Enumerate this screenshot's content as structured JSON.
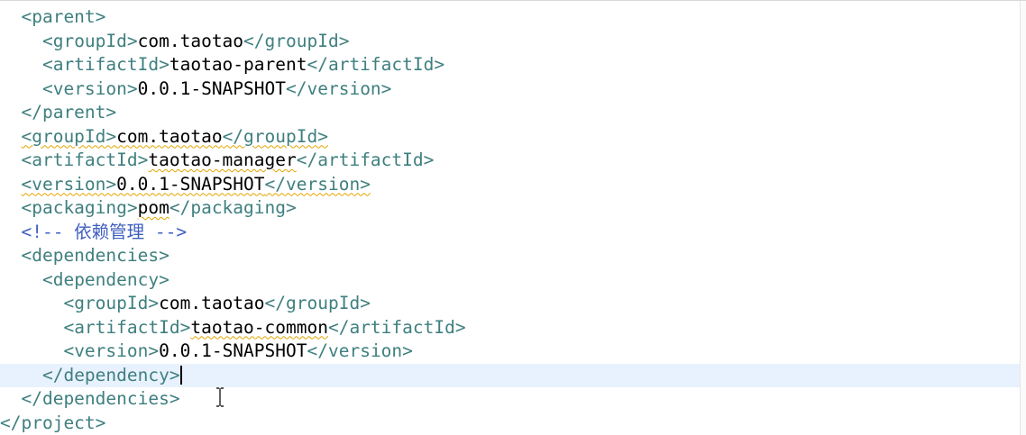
{
  "editor": {
    "lines": [
      {
        "indent": 2,
        "open": "<parent>",
        "value": "",
        "close": ""
      },
      {
        "indent": 4,
        "open": "<groupId>",
        "value": "com.taotao",
        "close": "</groupId>"
      },
      {
        "indent": 4,
        "open": "<artifactId>",
        "value": "taotao-parent",
        "close": "</artifactId>"
      },
      {
        "indent": 4,
        "open": "<version>",
        "value": "0.0.1-SNAPSHOT",
        "close": "</version>"
      },
      {
        "indent": 2,
        "open": "</parent>",
        "value": "",
        "close": ""
      },
      {
        "indent": 2,
        "open": "<groupId>",
        "value": "com.taotao",
        "close": "</groupId>"
      },
      {
        "indent": 2,
        "open": "<artifactId>",
        "value": "taotao-manager",
        "close": "</artifactId>"
      },
      {
        "indent": 2,
        "open": "<version>",
        "value": "0.0.1-SNAPSHOT",
        "close": "</version>"
      },
      {
        "indent": 2,
        "open": "<packaging>",
        "value": "pom",
        "close": "</packaging>"
      },
      {
        "indent": 2,
        "comment": "<!-- 依赖管理 -->"
      },
      {
        "indent": 2,
        "open": "<dependencies>",
        "value": "",
        "close": ""
      },
      {
        "indent": 4,
        "open": "<dependency>",
        "value": "",
        "close": ""
      },
      {
        "indent": 6,
        "open": "<groupId>",
        "value": "com.taotao",
        "close": "</groupId>"
      },
      {
        "indent": 6,
        "open": "<artifactId>",
        "value": "taotao-common",
        "close": "</artifactId>"
      },
      {
        "indent": 6,
        "open": "<version>",
        "value": "0.0.1-SNAPSHOT",
        "close": "</version>"
      },
      {
        "indent": 4,
        "open": "</dependency>",
        "value": "",
        "close": ""
      },
      {
        "indent": 2,
        "open": "</dependencies>",
        "value": "",
        "close": ""
      },
      {
        "indent": 0,
        "open": "</project>",
        "value": "",
        "close": ""
      }
    ],
    "current_line": 15,
    "colors": {
      "tag": "#3f7f7f",
      "comment": "#3f5fbf",
      "text": "#000000",
      "current_line_bg": "#e8f2fe",
      "spell_squiggle": "#e3a400"
    },
    "cursor_icon": "text-ibeam-icon"
  }
}
